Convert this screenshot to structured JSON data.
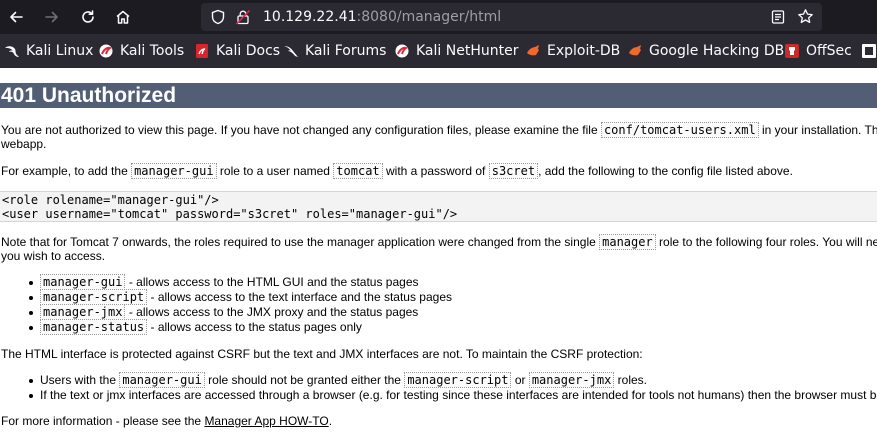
{
  "browser": {
    "url_host": "10.129.22.41",
    "url_rest": ":8080/manager/html"
  },
  "bookmarks": [
    {
      "label": "Kali Linux",
      "icon": "kali-dragon-icon"
    },
    {
      "label": "Kali Tools",
      "icon": "kali-tools-icon"
    },
    {
      "label": "Kali Docs",
      "icon": "kali-docs-icon"
    },
    {
      "label": "Kali Forums",
      "icon": "kali-forums-icon"
    },
    {
      "label": "Kali NetHunter",
      "icon": "kali-nethunter-icon"
    },
    {
      "label": "Exploit-DB",
      "icon": "exploit-db-icon"
    },
    {
      "label": "Google Hacking DB",
      "icon": "ghdb-icon"
    },
    {
      "label": "OffSec",
      "icon": "offsec-icon"
    }
  ],
  "page": {
    "title": "401 Unauthorized",
    "p1_a": "You are not authorized to view this page. If you have not changed any configuration files, please examine the file ",
    "p1_code": "conf/tomcat-users.xml",
    "p1_b": " in your installation. That",
    "p1_line2": "webapp.",
    "p2_a": "For example, to add the ",
    "p2_code1": "manager-gui",
    "p2_b": " role to a user named ",
    "p2_code2": "tomcat",
    "p2_c": " with a password of ",
    "p2_code3": "s3cret",
    "p2_d": ", add the following to the config file listed above.",
    "pre_line1": "<role rolename=\"manager-gui\"/>",
    "pre_line2": "<user username=\"tomcat\" password=\"s3cret\" roles=\"manager-gui\"/>",
    "p3_a": "Note that for Tomcat 7 onwards, the roles required to use the manager application were changed from the single ",
    "p3_code": "manager",
    "p3_b": " role to the following four roles. You will nee",
    "p3_line2": "you wish to access.",
    "roles": [
      {
        "code": "manager-gui",
        "text": " - allows access to the HTML GUI and the status pages"
      },
      {
        "code": "manager-script",
        "text": " - allows access to the text interface and the status pages"
      },
      {
        "code": "manager-jmx",
        "text": " - allows access to the JMX proxy and the status pages"
      },
      {
        "code": "manager-status",
        "text": " - allows access to the status pages only"
      }
    ],
    "p4": "The HTML interface is protected against CSRF but the text and JMX interfaces are not. To maintain the CSRF protection:",
    "csrf1_a": "Users with the ",
    "csrf1_code1": "manager-gui",
    "csrf1_b": " role should not be granted either the ",
    "csrf1_code2": "manager-script",
    "csrf1_c": " or ",
    "csrf1_code3": "manager-jmx",
    "csrf1_d": " roles.",
    "csrf2": "If the text or jmx interfaces are accessed through a browser (e.g. for testing since these interfaces are intended for tools not humans) then the browser must be",
    "p5_a": "For more information - please see the ",
    "p5_link": "Manager App HOW-TO",
    "p5_b": "."
  }
}
